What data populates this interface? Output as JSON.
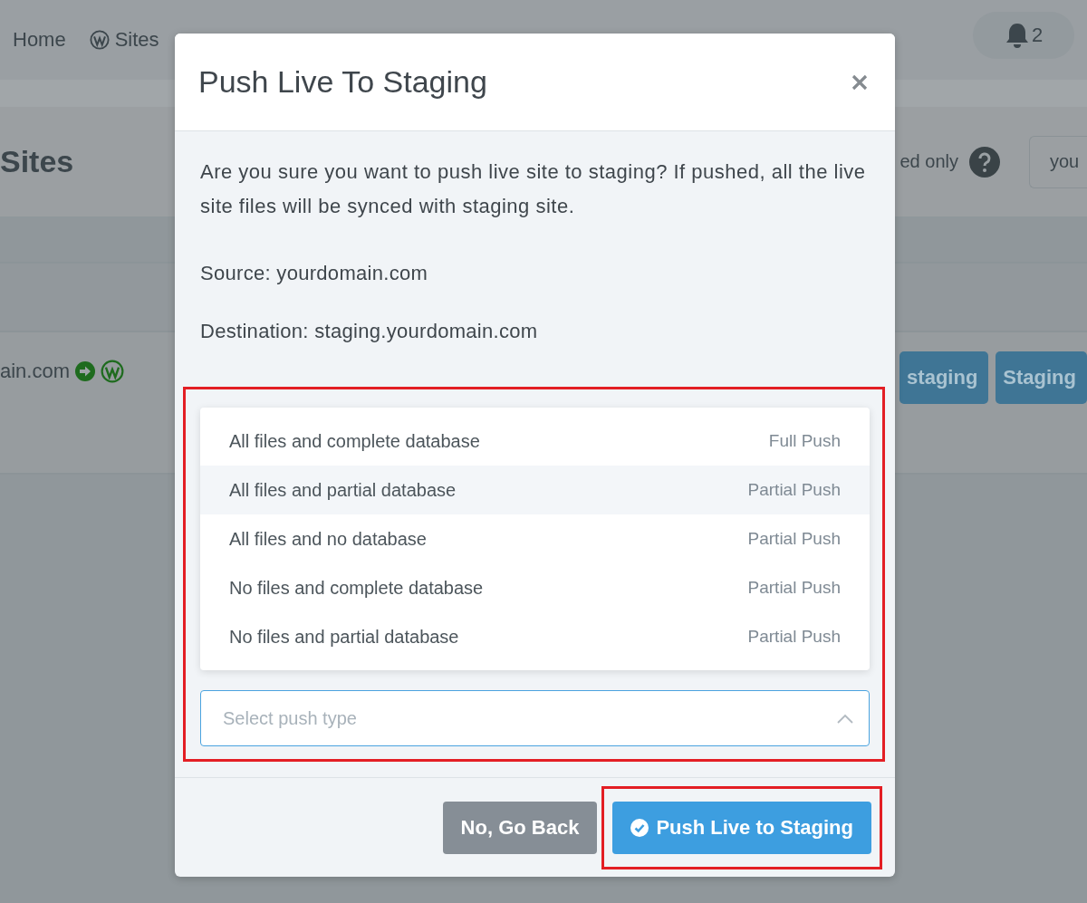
{
  "nav": {
    "items": [
      {
        "label": "Home"
      },
      {
        "label": "Sites"
      }
    ],
    "notifications": {
      "count": "2"
    }
  },
  "page": {
    "title": "Sites",
    "filter_label": "ed only",
    "search": {
      "value": "you"
    },
    "site_row": {
      "domain": "ain.com",
      "buttons": [
        "staging",
        "Staging"
      ]
    }
  },
  "modal": {
    "title": "Push Live To Staging",
    "message": "Are you sure you want to push live site to staging? If pushed, all the live site files will be synced with staging site.",
    "source": "Source: yourdomain.com",
    "destination": "Destination: staging.yourdomain.com",
    "options": [
      {
        "label": "All files and complete database",
        "tag": "Full Push",
        "selected": false
      },
      {
        "label": "All files and partial database",
        "tag": "Partial Push",
        "selected": true
      },
      {
        "label": "All files and no database",
        "tag": "Partial Push",
        "selected": false
      },
      {
        "label": "No files and complete database",
        "tag": "Partial Push",
        "selected": false
      },
      {
        "label": "No files and partial database",
        "tag": "Partial Push",
        "selected": false
      }
    ],
    "select": {
      "placeholder": "Select push type",
      "expanded": true,
      "highlighted": true
    },
    "buttons": [
      {
        "label": "No, Go Back",
        "kind": "secondary",
        "highlighted": false
      },
      {
        "label": "Push Live to Staging",
        "kind": "primary",
        "highlighted": true
      }
    ]
  }
}
